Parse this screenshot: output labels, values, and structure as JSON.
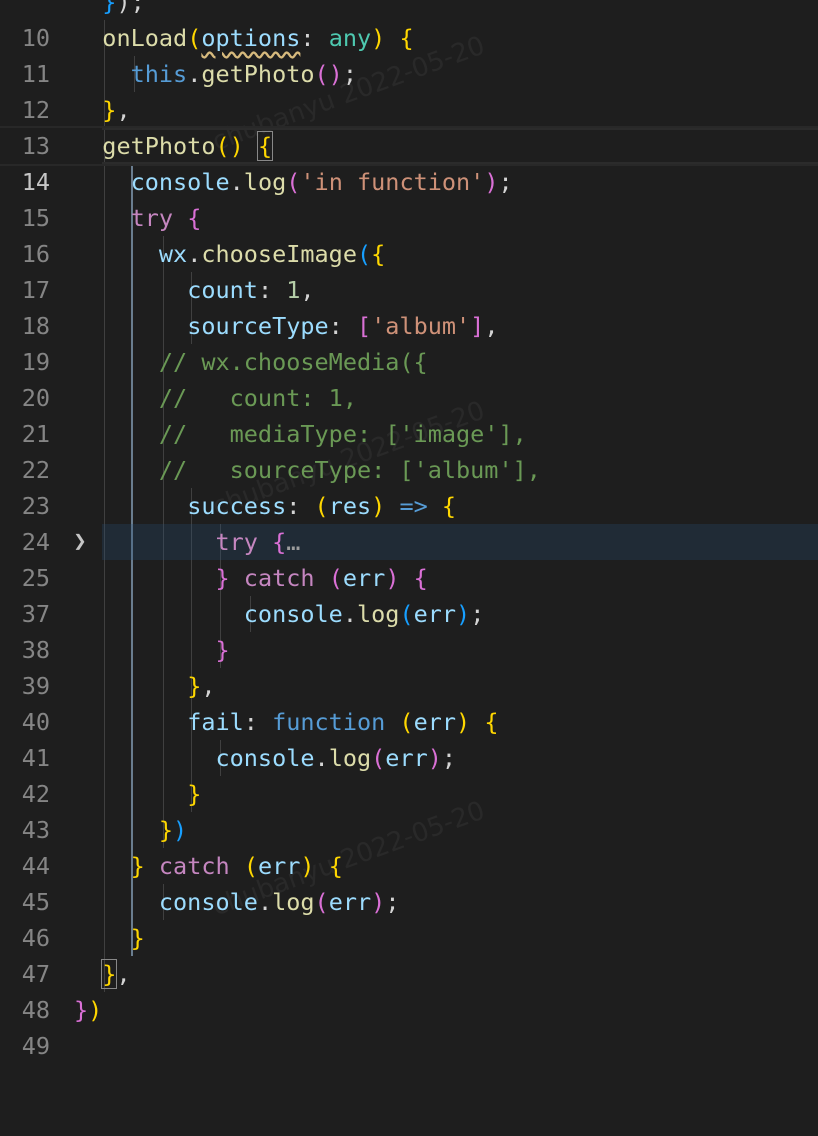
{
  "editor": {
    "lines": [
      {
        "n": "10",
        "code": "  });"
      },
      {
        "n": "11",
        "code": "  onLoad(options: any) {"
      },
      {
        "n": "12",
        "code": "    this.getPhoto();"
      },
      {
        "n": "13",
        "code": "  },"
      },
      {
        "n": "14",
        "code": "  getPhoto() {"
      },
      {
        "n": "15",
        "code": "    console.log('in function');"
      },
      {
        "n": "16",
        "code": "    try {"
      },
      {
        "n": "17",
        "code": "      wx.chooseImage({"
      },
      {
        "n": "18",
        "code": "        count: 1,"
      },
      {
        "n": "19",
        "code": "        sourceType: ['album'],"
      },
      {
        "n": "20",
        "code": "      // wx.chooseMedia({"
      },
      {
        "n": "21",
        "code": "      //   count: 1,"
      },
      {
        "n": "22",
        "code": "      //   mediaType: ['image'],"
      },
      {
        "n": "23",
        "code": "      //   sourceType: ['album'],"
      },
      {
        "n": "24",
        "code": "        success: (res) => {"
      },
      {
        "n": "25",
        "code": "          try {…"
      },
      {
        "n": "37",
        "code": "          } catch (err) {"
      },
      {
        "n": "38",
        "code": "            console.log(err);"
      },
      {
        "n": "39",
        "code": "          }"
      },
      {
        "n": "40",
        "code": "        },"
      },
      {
        "n": "41",
        "code": "        fail: function (err) {"
      },
      {
        "n": "42",
        "code": "          console.log(err);"
      },
      {
        "n": "43",
        "code": "        }"
      },
      {
        "n": "44",
        "code": "      })"
      },
      {
        "n": "45",
        "code": "    } catch (err) {"
      },
      {
        "n": "46",
        "code": "      console.log(err);"
      },
      {
        "n": "47",
        "code": "    }"
      },
      {
        "n": "48",
        "code": "  },"
      },
      {
        "n": "49",
        "code": "})"
      }
    ],
    "current_line": "14",
    "folded_line": "25",
    "fold_icon": "chevron-right-icon"
  },
  "colors": {
    "background": "#1e1e1e",
    "keyword": "#569cd6",
    "control": "#c586c0",
    "function": "#dcdcaa",
    "variable": "#9cdcfe",
    "string": "#ce9178",
    "comment": "#6a9955",
    "bracket_gold": "#ffd700",
    "bracket_pink": "#da70d6",
    "bracket_blue": "#179fff"
  }
}
